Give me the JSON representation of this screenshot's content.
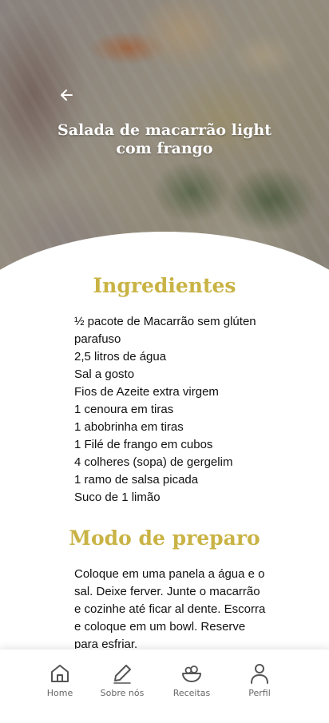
{
  "header": {
    "title": "Salada de macarrão light com frango",
    "back_icon": "arrow-left-icon"
  },
  "ingredients": {
    "heading": "Ingredientes",
    "items": [
      "½ pacote de Macarrão sem glúten parafuso",
      "2,5 litros de água",
      "Sal a gosto",
      "Fios de Azeite extra virgem",
      "1 cenoura em tiras",
      "1 abobrinha em tiras",
      "1 Filé de frango em cubos",
      "4 colheres (sopa) de gergelim",
      "1 ramo de salsa picada",
      "Suco de 1 limão"
    ]
  },
  "preparation": {
    "heading": "Modo de preparo",
    "text": "Coloque em uma panela a água e o sal. Deixe ferver. Junte o macarrão e cozinhe até ficar al dente. Escorra e coloque em um bowl. Reserve para esfriar."
  },
  "nav": {
    "items": [
      {
        "label": "Home",
        "icon": "home-icon"
      },
      {
        "label": "Sobre nós",
        "icon": "pen-icon"
      },
      {
        "label": "Receitas",
        "icon": "bowl-icon"
      },
      {
        "label": "Perfil",
        "icon": "user-icon"
      }
    ]
  },
  "colors": {
    "accent": "#c9b345",
    "text": "#111111",
    "nav_text": "#666666"
  }
}
